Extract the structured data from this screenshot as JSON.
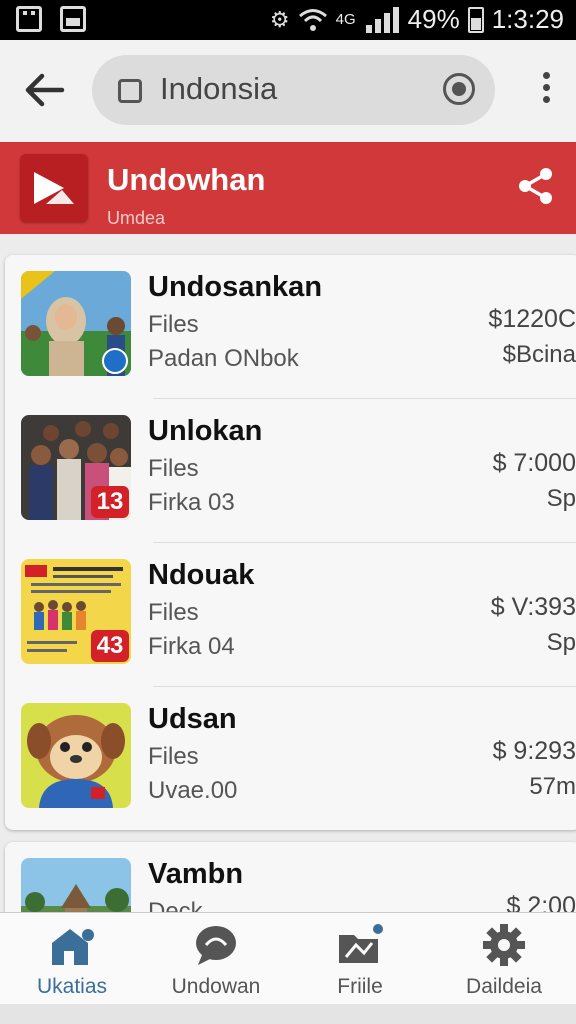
{
  "status_bar": {
    "time": "1:3:29",
    "battery": "49%",
    "network": "4G"
  },
  "search": {
    "query": "Indonsia"
  },
  "banner": {
    "title": "Undowhan",
    "subtitle": "Umdea",
    "color": "#d0383a"
  },
  "list": [
    {
      "title": "Undosankan",
      "subtitle": "Files",
      "detail": "Padan ONbok",
      "price": "$1220C",
      "meta": "$Bcina",
      "badge": ""
    },
    {
      "title": "Unlokan",
      "subtitle": "Files",
      "detail": "Firka 03",
      "price": "$ 7:000",
      "meta": "Sp",
      "badge": "13"
    },
    {
      "title": "Ndouak",
      "subtitle": "Files",
      "detail": "Firka 04",
      "price": "$ V:393",
      "meta": "Sp",
      "badge": "43"
    },
    {
      "title": "Udsan",
      "subtitle": "Files",
      "detail": "Uvae.00",
      "price": "$ 9:293",
      "meta": "57m",
      "badge": ""
    }
  ],
  "list_partial": {
    "title": "Vambn",
    "subtitle": "Deck",
    "price": "$ 2:00"
  },
  "nav": {
    "items": [
      {
        "label": "Ukatias",
        "icon": "home-icon",
        "active": true
      },
      {
        "label": "Undowan",
        "icon": "chat-icon",
        "active": false
      },
      {
        "label": "Friile",
        "icon": "folder-icon",
        "active": false
      },
      {
        "label": "Daildeia",
        "icon": "gear-icon",
        "active": false
      }
    ]
  }
}
